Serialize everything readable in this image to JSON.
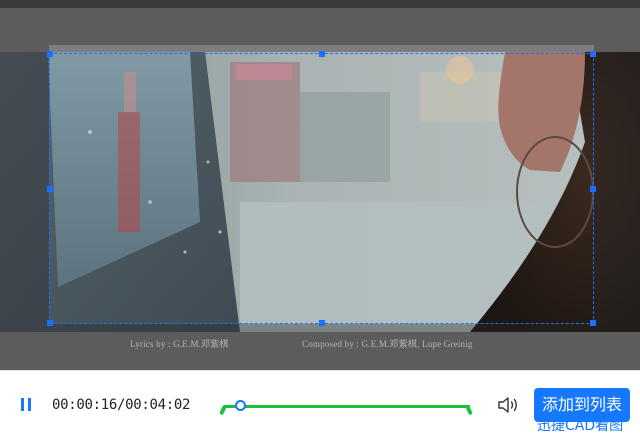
{
  "player": {
    "subtitles": {
      "lyrics": "Lyrics by : G.E.M.邓紫棋",
      "composer": "Composed by : G.E.M.邓紫棋, Lupe Greinig"
    },
    "controls": {
      "play_state": "playing",
      "time_display": "00:00:16/00:04:02",
      "progress_fraction": 0.066,
      "add_to_list_label": "添加到列表",
      "overflow_text": "迅捷CAD看图"
    }
  },
  "icons": {
    "pause": "pause-icon",
    "volume": "volume-icon"
  },
  "colors": {
    "accent": "#1677ff",
    "range": "#19c23a",
    "crop_border": "#1e6fff"
  }
}
